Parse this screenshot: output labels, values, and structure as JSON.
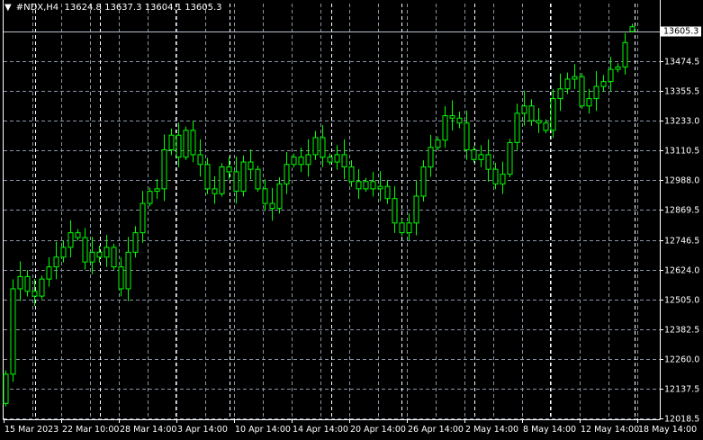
{
  "header": {
    "symbol": "#NDX,H4",
    "open": "13624.8",
    "high": "13637.3",
    "low": "13604.1",
    "close": "13605.3"
  },
  "current_price": "13605.3",
  "price_axis": [
    "13474.5",
    "13355.5",
    "13233.0",
    "13110.5",
    "12988.0",
    "12869.5",
    "12746.5",
    "12624.0",
    "12505.0",
    "12382.5",
    "12260.0",
    "12137.5",
    "12018.5"
  ],
  "time_axis": [
    "15 Mar 2023",
    "22 Mar 10:00",
    "28 Mar 14:00",
    "3 Apr 14:00",
    "10 Apr 14:00",
    "14 Apr 14:00",
    "20 Apr 14:00",
    "26 Apr 14:00",
    "2 May 14:00",
    "8 May 14:00",
    "12 May 14:00",
    "18 May 14:00"
  ],
  "colors": {
    "candle": "#00ff00",
    "grid": "#8a94a6",
    "bg": "#000000"
  },
  "chart_data": {
    "type": "candlestick",
    "ylim": [
      12018.5,
      13605.3
    ],
    "first_open": 12080,
    "closes": [
      12200,
      12550,
      12600,
      12540,
      12520,
      12590,
      12640,
      12680,
      12720,
      12780,
      12760,
      12660,
      12700,
      12680,
      12720,
      12640,
      12550,
      12700,
      12780,
      12900,
      12950,
      12960,
      13120,
      13180,
      13090,
      13200,
      13100,
      13060,
      12960,
      12940,
      13050,
      13030,
      12950,
      13070,
      13040,
      12960,
      12900,
      12880,
      12980,
      13060,
      13090,
      13060,
      13100,
      13170,
      13090,
      13070,
      13100,
      13050,
      12990,
      12960,
      12990,
      12960,
      12970,
      12920,
      12820,
      12780,
      12820,
      12930,
      13050,
      13130,
      13160,
      13260,
      13250,
      13230,
      13120,
      13080,
      13100,
      13040,
      12980,
      13020,
      13150,
      13270,
      13300,
      13240,
      13230,
      13200,
      13330,
      13370,
      13410,
      13420,
      13300,
      13330,
      13380,
      13400,
      13450,
      13460,
      13560,
      13605.3
    ],
    "last_bar": {
      "open": 13624.8,
      "high": 13637.3,
      "low": 13604.1,
      "close": 13605.3
    }
  }
}
